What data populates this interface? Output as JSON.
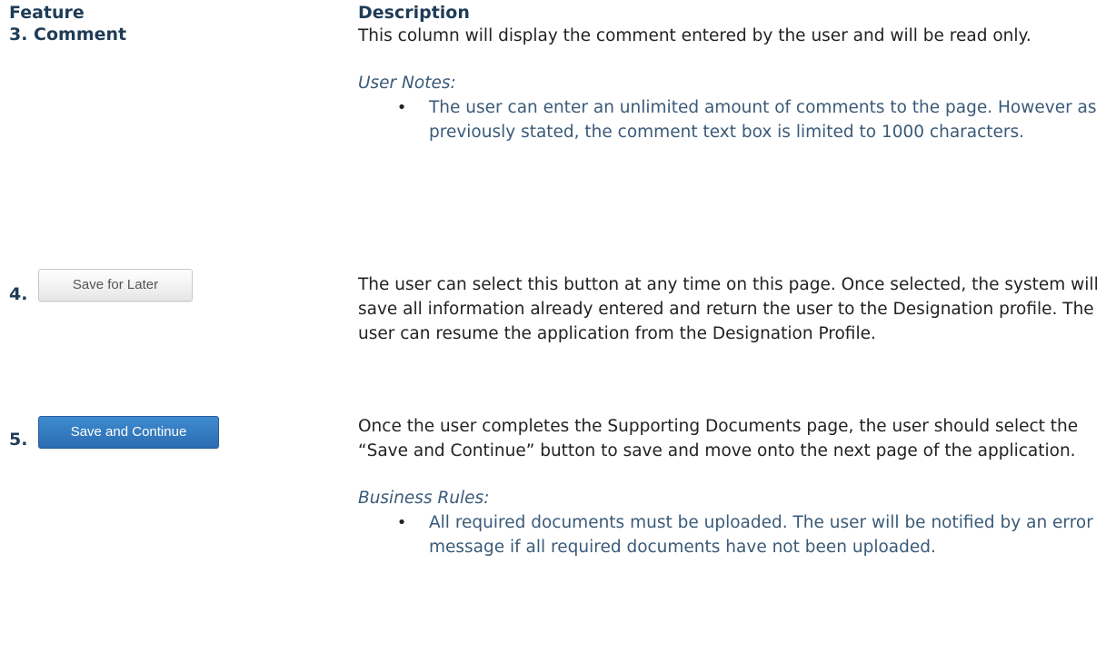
{
  "header": {
    "feature": "Feature",
    "description": "Description"
  },
  "rows": [
    {
      "feature_label": "3. Comment",
      "description": "This column will display the comment entered by the user and will be read only.",
      "note_heading": "User Notes:",
      "bullets": [
        "The user can enter an unlimited amount of comments to the page. However as previously stated, the comment text box is limited to 1000 characters."
      ]
    },
    {
      "number": "4.",
      "button_label": "Save for Later",
      "description": "The user can select this button at any time on this page. Once selected, the system will save all information already entered and return the user to the Designation profile. The user can resume the application from the Designation Profile."
    },
    {
      "number": "5.",
      "button_label": "Save and Continue",
      "description": "Once the user completes the Supporting Documents page, the user should select the “Save and Continue” button to save and move onto the next page of the application.",
      "note_heading": "Business Rules:",
      "bullets": [
        "All required documents must be uploaded. The user will be notified by an error message if all required documents have not been uploaded."
      ]
    }
  ],
  "colors": {
    "heading": "#1f3c57",
    "note_text": "#3a5a78",
    "body_text": "#222222",
    "primary_button": "#2b6cb0",
    "secondary_button": "#e6e6e6"
  }
}
